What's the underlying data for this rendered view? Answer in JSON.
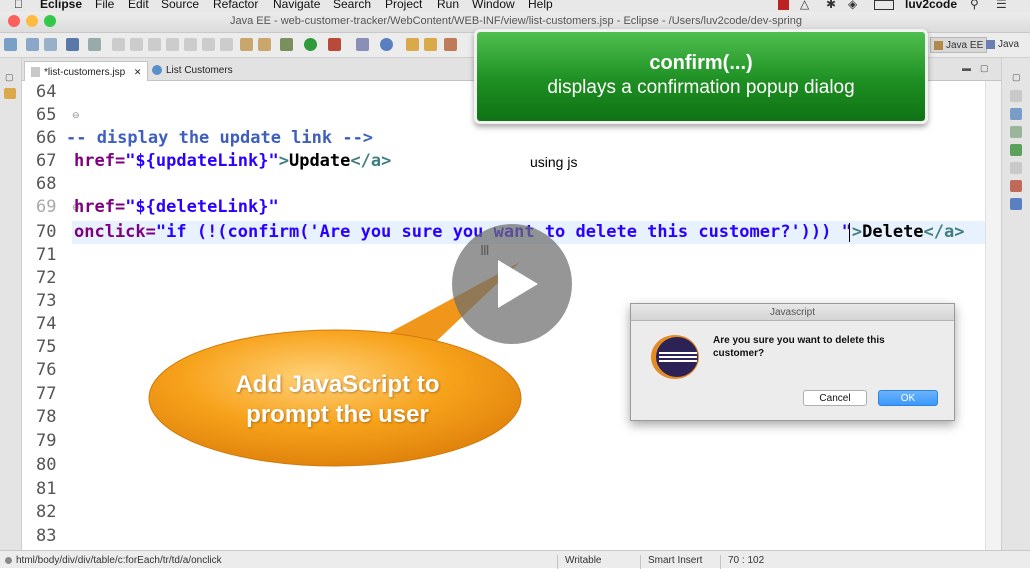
{
  "menubar": {
    "apple": "",
    "app": "Eclipse",
    "items": [
      "File",
      "Edit",
      "Source",
      "Refactor",
      "Navigate",
      "Search",
      "Project",
      "Run",
      "Window",
      "Help"
    ],
    "user": "luv2code"
  },
  "window": {
    "title": "Java EE - web-customer-tracker/WebContent/WEB-INF/view/list-customers.jsp - Eclipse - /Users/luv2code/dev-spring"
  },
  "perspectives": {
    "java_ee": "Java EE",
    "java": "Java"
  },
  "tabs": [
    {
      "label": "*list-customers.jsp",
      "close": "✕"
    },
    {
      "label": "List Customers"
    }
  ],
  "editor": {
    "line_numbers": [
      "64",
      "65",
      "66",
      "67",
      "68",
      "69",
      "70",
      "71",
      "72",
      "73",
      "74",
      "75",
      "76",
      "77",
      "78",
      "79",
      "80",
      "81",
      "82",
      "83"
    ],
    "line66": {
      "comment": "-- display the update link -->"
    },
    "line67": {
      "attr": "href=",
      "value": "\"${updateLink}\"",
      "tag_close": ">",
      "text": "Update",
      "end_tag": "</a>"
    },
    "line69": {
      "attr": "href=",
      "value": "\"${deleteLink}\""
    },
    "line70": {
      "attr": "onclick=",
      "value": "\"if (!(confirm('Are you sure you want to delete this customer?'))) \"",
      "tag_close": ">",
      "text": "Delete",
      "end_tag": "</a>"
    }
  },
  "annotation": {
    "using_js": "using js"
  },
  "callout": {
    "title": "confirm(...)",
    "subtitle": "displays a confirmation popup dialog"
  },
  "bubble": {
    "line1": "Add JavaScript to",
    "line2": "prompt the user"
  },
  "dialog": {
    "title": "Javascript",
    "message": "Are you sure you want to delete this customer?",
    "cancel": "Cancel",
    "ok": "OK"
  },
  "status": {
    "path": "html/body/div/div/table/c:forEach/tr/td/a/onclick",
    "writable": "Writable",
    "insert_mode": "Smart Insert",
    "position": "70 : 102"
  },
  "colors": {
    "callout_green": "#1e8f22",
    "bubble_orange": "#f7a21b",
    "ok_blue": "#3b99fc"
  }
}
